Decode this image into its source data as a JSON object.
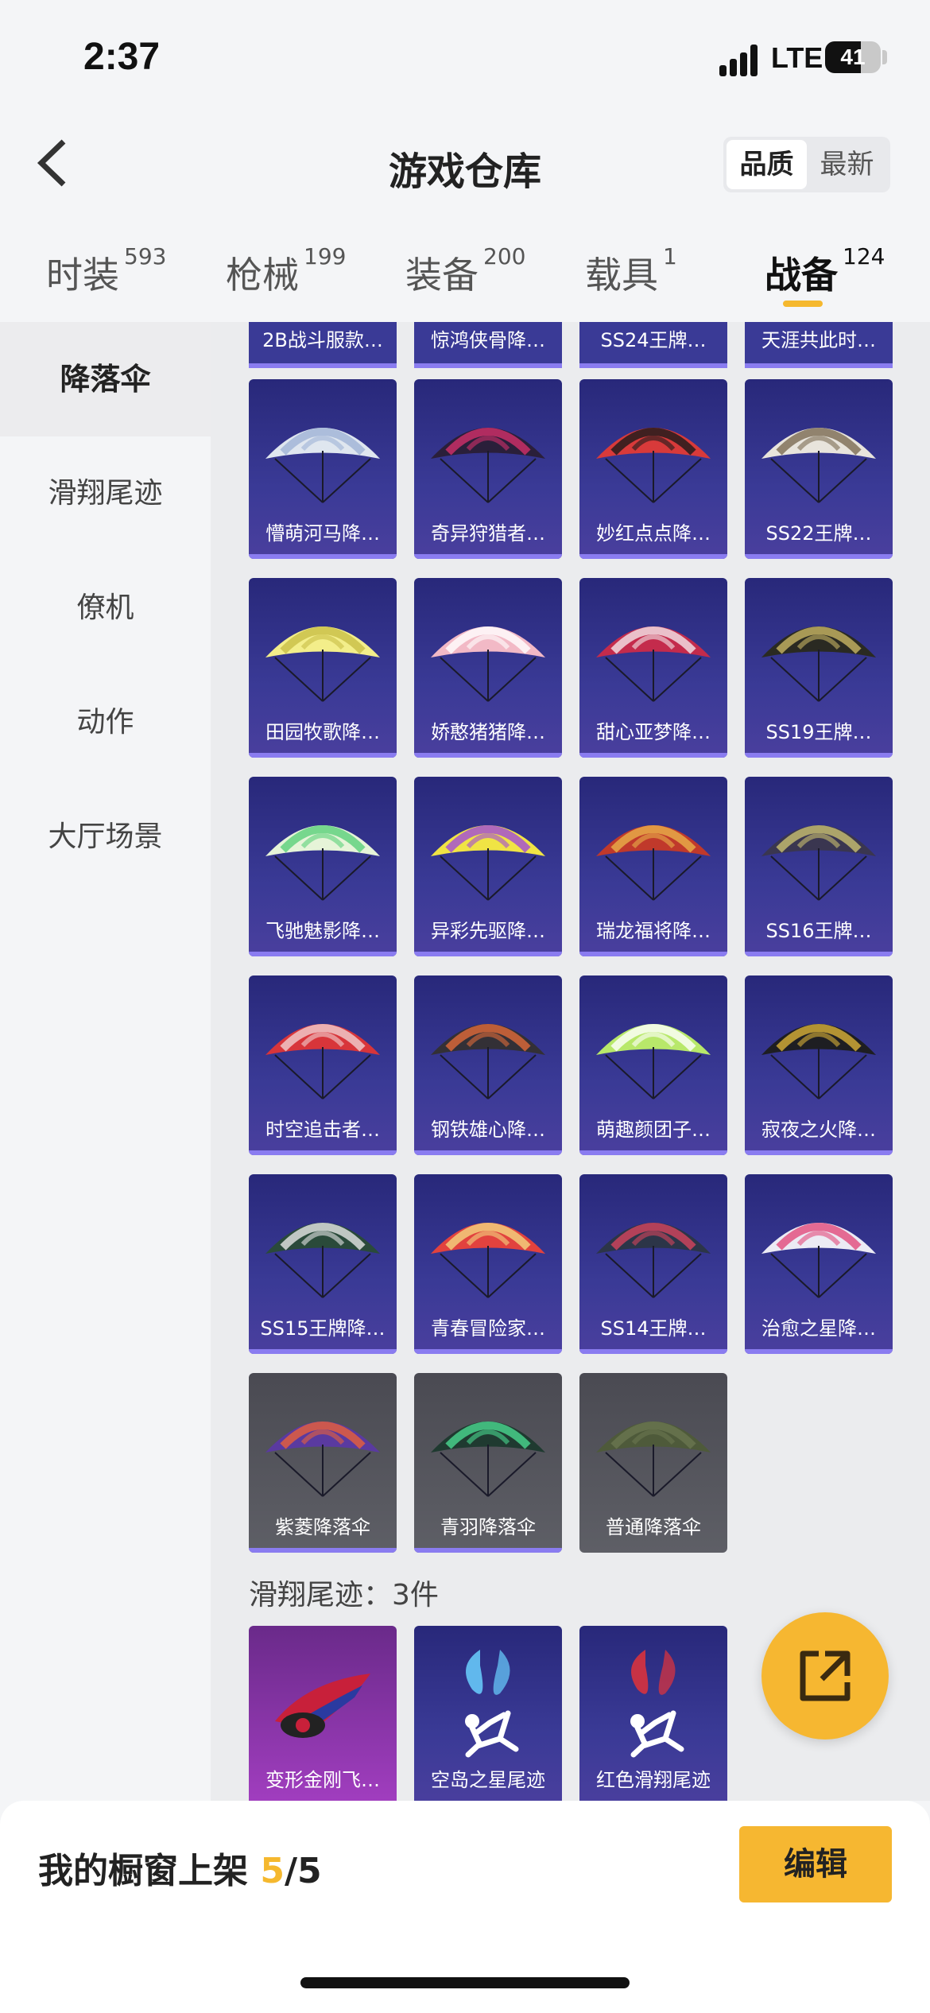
{
  "status": {
    "time": "2:37",
    "network": "LTE",
    "battery": "41"
  },
  "header": {
    "title": "游戏仓库",
    "sort_options": [
      "品质",
      "最新"
    ],
    "sort_selected": "品质"
  },
  "tabs": [
    {
      "label": "时装",
      "count": "593"
    },
    {
      "label": "枪械",
      "count": "199"
    },
    {
      "label": "装备",
      "count": "200"
    },
    {
      "label": "载具",
      "count": "1"
    },
    {
      "label": "战备",
      "count": "124"
    }
  ],
  "sidebar": {
    "items": [
      "降落伞",
      "滑翔尾迹",
      "僚机",
      "动作",
      "大厅场景"
    ],
    "selected": "降落伞"
  },
  "top_row": [
    "2B战斗服款…",
    "惊鸿侠骨降…",
    "SS24王牌…",
    "天涯共此时…"
  ],
  "parachutes": [
    {
      "name": "懵萌河马降…",
      "icon": "parachute-white-icon",
      "colors": [
        "#dfe6ef",
        "#9fb3d6"
      ]
    },
    {
      "name": "奇异狩猎者…",
      "icon": "parachute-dark-icon",
      "colors": [
        "#2a1f3a",
        "#d2306a"
      ]
    },
    {
      "name": "妙红点点降…",
      "icon": "parachute-ladybug-icon",
      "colors": [
        "#d83a3a",
        "#1a1a1a"
      ]
    },
    {
      "name": "SS22王牌…",
      "icon": "parachute-ss22-icon",
      "colors": [
        "#e8e4dc",
        "#7a6a52"
      ]
    },
    {
      "name": "田园牧歌降…",
      "icon": "parachute-yellow-icon",
      "colors": [
        "#f3ee8a",
        "#c8be46"
      ]
    },
    {
      "name": "娇憨猪猪降…",
      "icon": "parachute-pig-icon",
      "colors": [
        "#f2b9c6",
        "#ffffff"
      ]
    },
    {
      "name": "甜心亚梦降…",
      "icon": "parachute-sweetheart-icon",
      "colors": [
        "#c42b4c",
        "#f4e6ea"
      ]
    },
    {
      "name": "SS19王牌…",
      "icon": "parachute-ss19-icon",
      "colors": [
        "#2a2a22",
        "#c8b564"
      ]
    },
    {
      "name": "飞驰魅影降…",
      "icon": "parachute-rainbow-icon",
      "colors": [
        "#e6f4d8",
        "#5ad07a"
      ]
    },
    {
      "name": "异彩先驱降…",
      "icon": "parachute-colorful-icon",
      "colors": [
        "#f0e444",
        "#a04ad8"
      ]
    },
    {
      "name": "瑞龙福将降…",
      "icon": "parachute-dragon-icon",
      "colors": [
        "#c0392b",
        "#e8b04a"
      ]
    },
    {
      "name": "SS16王牌…",
      "icon": "parachute-ss16-icon",
      "colors": [
        "#3a3650",
        "#c9c070"
      ]
    },
    {
      "name": "时空追击者…",
      "icon": "parachute-red-icon",
      "colors": [
        "#d8353a",
        "#f1d0d0"
      ]
    },
    {
      "name": "钢铁雄心降…",
      "icon": "parachute-steel-icon",
      "colors": [
        "#333036",
        "#e06a3a"
      ]
    },
    {
      "name": "萌趣颜团子…",
      "icon": "parachute-green-icon",
      "colors": [
        "#b8e86a",
        "#ffffff"
      ]
    },
    {
      "name": "寂夜之火降…",
      "icon": "parachute-nightfire-icon",
      "colors": [
        "#1e1e22",
        "#d8b038"
      ]
    },
    {
      "name": "SS15王牌降…",
      "icon": "parachute-ss15-icon",
      "colors": [
        "#2a4a3a",
        "#e6e6e6"
      ]
    },
    {
      "name": "青春冒险家…",
      "icon": "parachute-speed-icon",
      "colors": [
        "#e2423e",
        "#f4d680"
      ]
    },
    {
      "name": "SS14王牌…",
      "icon": "parachute-ss14-icon",
      "colors": [
        "#2c3548",
        "#d6455e"
      ]
    },
    {
      "name": "治愈之星降…",
      "icon": "parachute-star-icon",
      "colors": [
        "#ecebf4",
        "#e24a7a"
      ]
    },
    {
      "name": "紫菱降落伞",
      "icon": "parachute-purple-icon",
      "colors": [
        "#5a3aa0",
        "#e8603a"
      ],
      "quality": "gray"
    },
    {
      "name": "青羽降落伞",
      "icon": "parachute-feather-icon",
      "colors": [
        "#1f3a30",
        "#4ad890"
      ],
      "quality": "gray"
    },
    {
      "name": "普通降落伞",
      "icon": "parachute-plain-icon",
      "colors": [
        "#4e5a3a",
        "#6a7650"
      ],
      "quality": "gray-nobar"
    }
  ],
  "section": {
    "label": "滑翔尾迹：3件"
  },
  "trails": [
    {
      "name": "变形金刚飞…",
      "icon": "jet-icon",
      "colors": [
        "#c8203a",
        "#2a3aa0"
      ],
      "quality": "pink"
    },
    {
      "name": "空岛之星尾迹",
      "icon": "skydiver-rainbow-icon",
      "colors": [
        "#ffffff",
        "#6ad0ff"
      ]
    },
    {
      "name": "红色滑翔尾迹",
      "icon": "skydiver-red-icon",
      "colors": [
        "#ffffff",
        "#e2333a"
      ]
    }
  ],
  "bottom": {
    "label": "我的橱窗上架",
    "shown": "5",
    "total": "/5",
    "edit_label": "编辑"
  }
}
